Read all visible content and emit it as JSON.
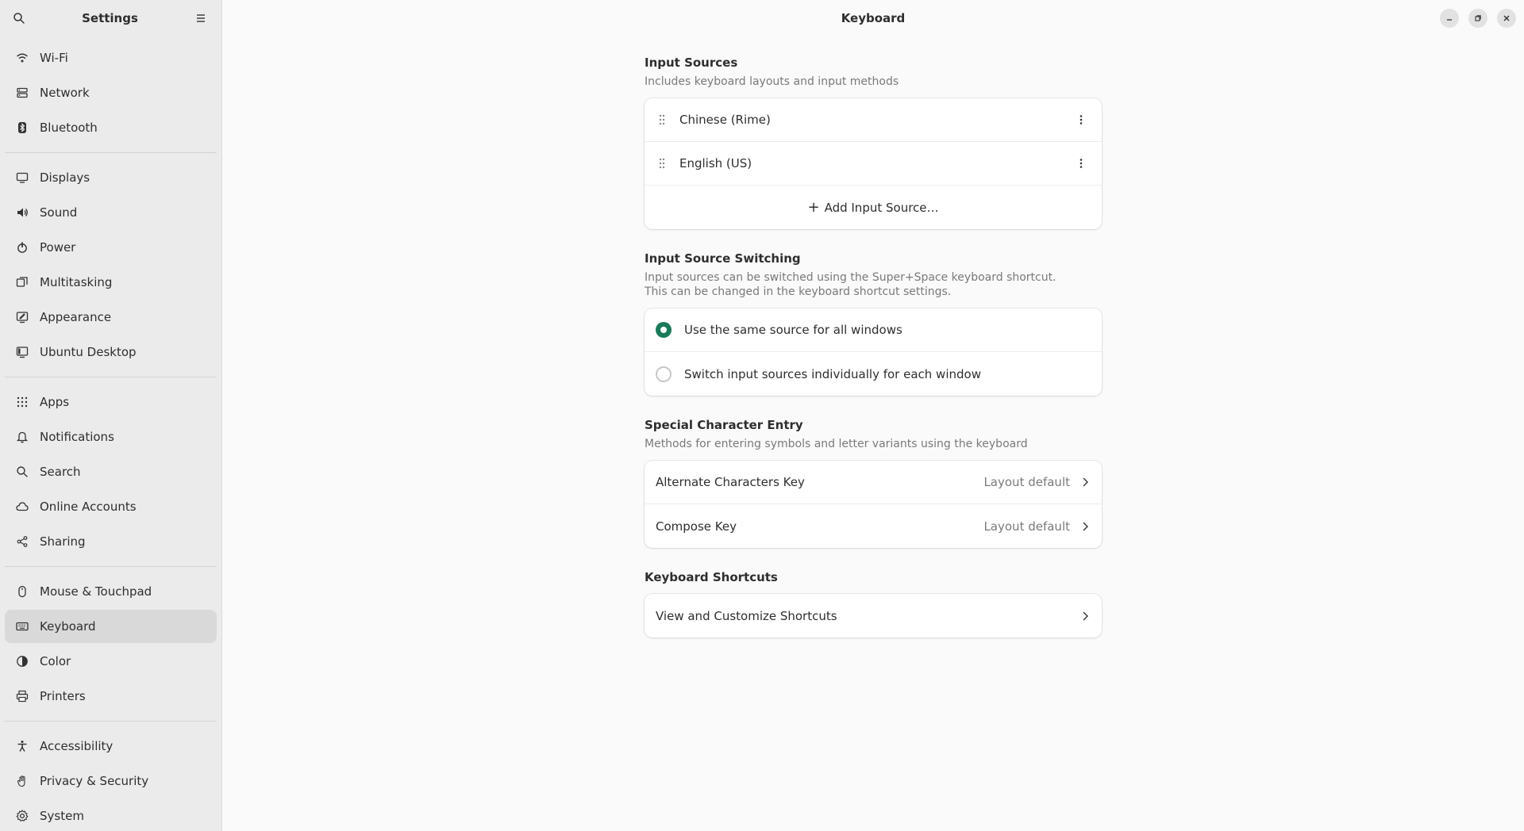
{
  "sidebar": {
    "title": "Settings",
    "groups": [
      [
        {
          "label": "Wi-Fi",
          "icon": "wifi-icon"
        },
        {
          "label": "Network",
          "icon": "network-icon"
        },
        {
          "label": "Bluetooth",
          "icon": "bluetooth-icon"
        }
      ],
      [
        {
          "label": "Displays",
          "icon": "display-icon"
        },
        {
          "label": "Sound",
          "icon": "speaker-icon"
        },
        {
          "label": "Power",
          "icon": "power-icon"
        },
        {
          "label": "Multitasking",
          "icon": "multitasking-icon"
        },
        {
          "label": "Appearance",
          "icon": "appearance-icon"
        },
        {
          "label": "Ubuntu Desktop",
          "icon": "ubuntu-desktop-icon"
        }
      ],
      [
        {
          "label": "Apps",
          "icon": "apps-grid-icon"
        },
        {
          "label": "Notifications",
          "icon": "bell-icon"
        },
        {
          "label": "Search",
          "icon": "search-icon"
        },
        {
          "label": "Online Accounts",
          "icon": "cloud-icon"
        },
        {
          "label": "Sharing",
          "icon": "share-icon"
        }
      ],
      [
        {
          "label": "Mouse & Touchpad",
          "icon": "mouse-icon"
        },
        {
          "label": "Keyboard",
          "icon": "keyboard-icon",
          "active": true
        },
        {
          "label": "Color",
          "icon": "color-icon"
        },
        {
          "label": "Printers",
          "icon": "printer-icon"
        }
      ],
      [
        {
          "label": "Accessibility",
          "icon": "accessibility-icon"
        },
        {
          "label": "Privacy & Security",
          "icon": "hand-icon"
        },
        {
          "label": "System",
          "icon": "gear-icon"
        }
      ]
    ]
  },
  "header": {
    "title": "Keyboard"
  },
  "input_sources": {
    "title": "Input Sources",
    "description": "Includes keyboard layouts and input methods",
    "items": [
      "Chinese (Rime)",
      "English (US)"
    ],
    "add_label": "Add Input Source…"
  },
  "switching": {
    "title": "Input Source Switching",
    "description_line1": "Input sources can be switched using the Super+Space keyboard shortcut.",
    "description_line2": "This can be changed in the keyboard shortcut settings.",
    "options": [
      {
        "label": "Use the same source for all windows",
        "checked": true
      },
      {
        "label": "Switch input sources individually for each window",
        "checked": false
      }
    ]
  },
  "special": {
    "title": "Special Character Entry",
    "description": "Methods for entering symbols and letter variants using the keyboard",
    "rows": [
      {
        "label": "Alternate Characters Key",
        "value": "Layout default"
      },
      {
        "label": "Compose Key",
        "value": "Layout default"
      }
    ]
  },
  "shortcuts": {
    "title": "Keyboard Shortcuts",
    "row_label": "View and Customize Shortcuts"
  },
  "colors": {
    "accent": "#1b7a5a",
    "sidebar_bg": "#ebebeb",
    "content_bg": "#fafafa"
  }
}
